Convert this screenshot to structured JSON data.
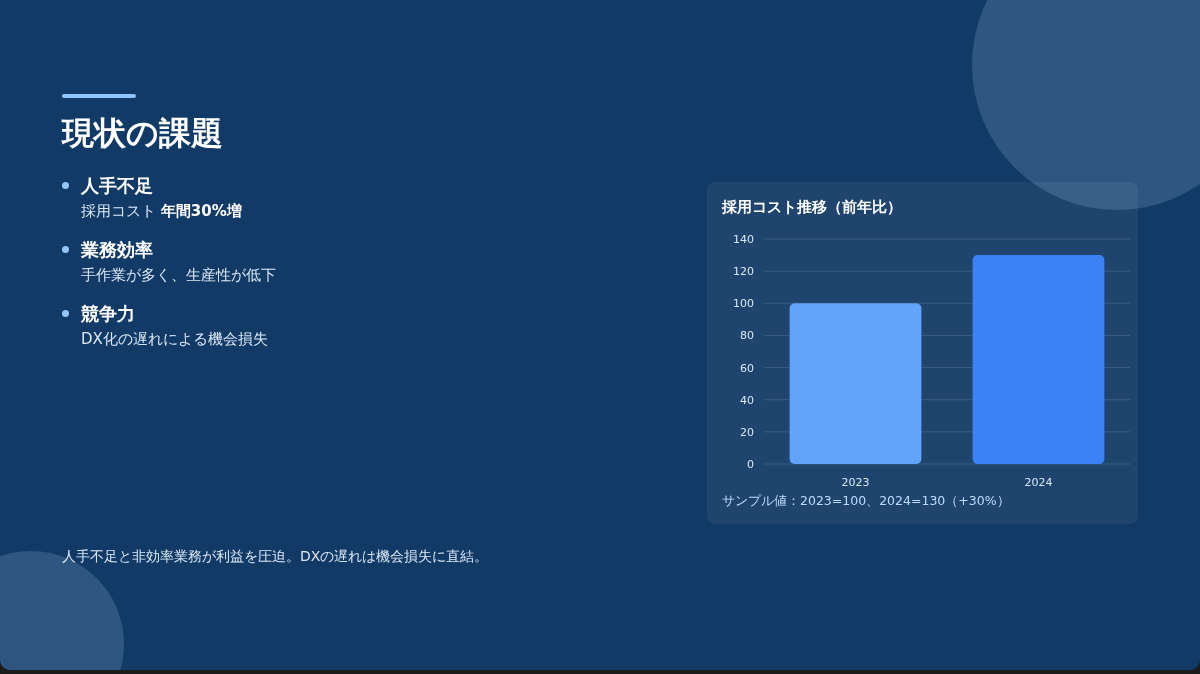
{
  "slide": {
    "title": "現状の課題",
    "points": [
      {
        "heading": "人手不足",
        "detail": "採用コスト **年間30%増**"
      },
      {
        "heading": "業務効率",
        "detail": "手作業が多く、生産性が低下"
      },
      {
        "heading": "競争力",
        "detail": "DX化の遅れによる機会損失"
      }
    ],
    "chart_card": {
      "chart_data": {
        "type": "bar",
        "title": "採用コスト推移（前年比）",
        "categories": [
          "2023",
          "2024"
        ],
        "grid": true,
        "ylim": [
          0,
          140
        ],
        "yticks": [
          0,
          20,
          40,
          60,
          80,
          100,
          120,
          140
        ],
        "series": [
          {
            "colors": [
              "#60a5fa",
              "#3b82f6"
            ],
            "values": [
              100,
              130
            ]
          }
        ]
      },
      "note": "サンプル値：2023=100、2024=130（+30%）"
    },
    "footer": "人手不足と非効率業務が利益を圧迫。DXの遅れは機会損失に直結。"
  }
}
